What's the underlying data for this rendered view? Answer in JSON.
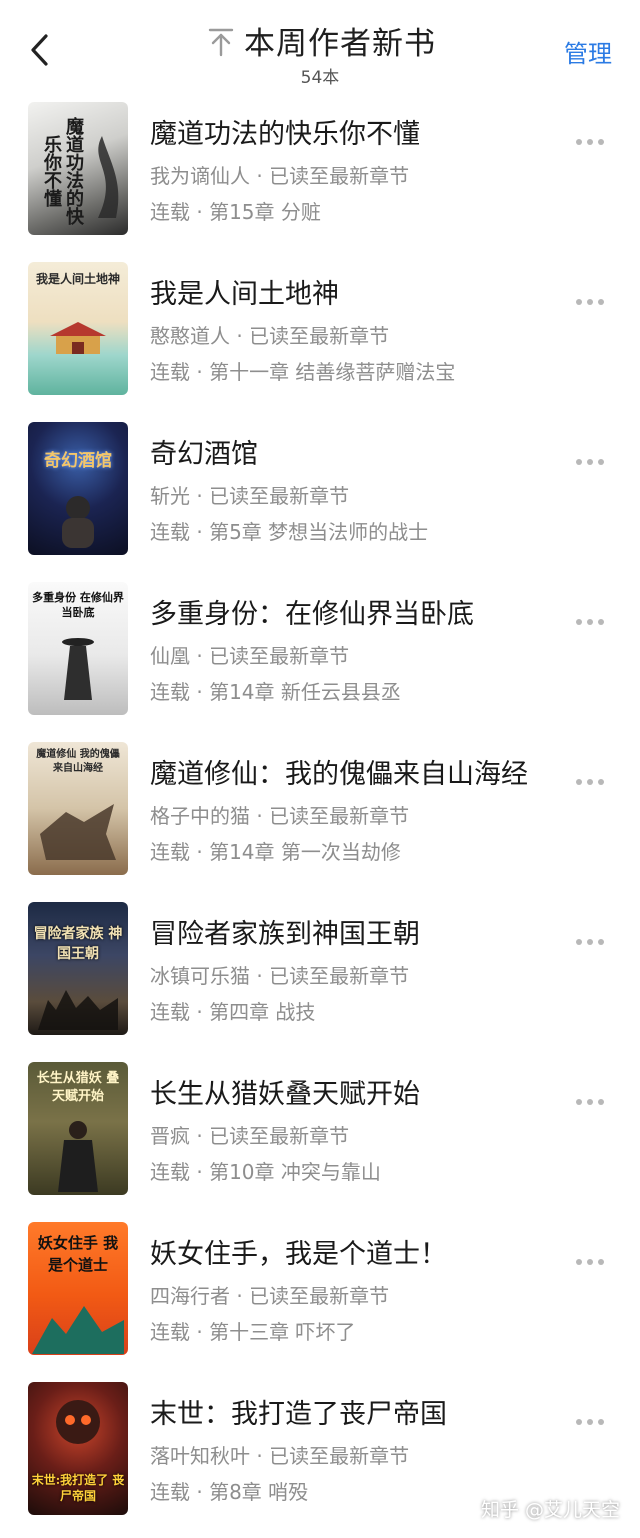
{
  "header": {
    "title": "本周作者新书",
    "count": "54本",
    "manage_label": "管理"
  },
  "colors": {
    "accent": "#2b7be4",
    "secondary_text": "#8e8e8e"
  },
  "books": [
    {
      "title": "魔道功法的快乐你不懂",
      "author_line": "我为谪仙人 · 已读至最新章节",
      "status_line": "连载 · 第15章 分赃",
      "cover_text": "魔道功法的快乐你不懂"
    },
    {
      "title": "我是人间土地神",
      "author_line": "憨憨道人 · 已读至最新章节",
      "status_line": "连载 · 第十一章 结善缘菩萨赠法宝",
      "cover_text": "我是人间土地神"
    },
    {
      "title": "奇幻酒馆",
      "author_line": "斩光 · 已读至最新章节",
      "status_line": "连载 · 第5章 梦想当法师的战士",
      "cover_text": "奇幻酒馆"
    },
    {
      "title": "多重身份：在修仙界当卧底",
      "author_line": "仙凰 · 已读至最新章节",
      "status_line": "连载 · 第14章 新任云县县丞",
      "cover_text": "多重身份 在修仙界当卧底"
    },
    {
      "title": "魔道修仙：我的傀儡来自山海经",
      "author_line": "格子中的猫 · 已读至最新章节",
      "status_line": "连载 · 第14章 第一次当劫修",
      "cover_text": "魔道修仙 我的傀儡来自山海经"
    },
    {
      "title": "冒险者家族到神国王朝",
      "author_line": "冰镇可乐猫 · 已读至最新章节",
      "status_line": "连载 · 第四章 战技",
      "cover_text": "冒险者家族 神国王朝"
    },
    {
      "title": "长生从猎妖叠天赋开始",
      "author_line": "晋疯 · 已读至最新章节",
      "status_line": "连载 · 第10章 冲突与靠山",
      "cover_text": "长生从猎妖 叠天赋开始"
    },
    {
      "title": "妖女住手，我是个道士！",
      "author_line": "四海行者 · 已读至最新章节",
      "status_line": "连载 · 第十三章 吓坏了",
      "cover_text": "妖女住手 我是个道士"
    },
    {
      "title": "末世：我打造了丧尸帝国",
      "author_line": "落叶知秋叶 · 已读至最新章节",
      "status_line": "连载 · 第8章 哨殁",
      "cover_text": "末世:我打造了 丧尸帝国"
    }
  ],
  "watermark": "知乎 @艾儿天空"
}
